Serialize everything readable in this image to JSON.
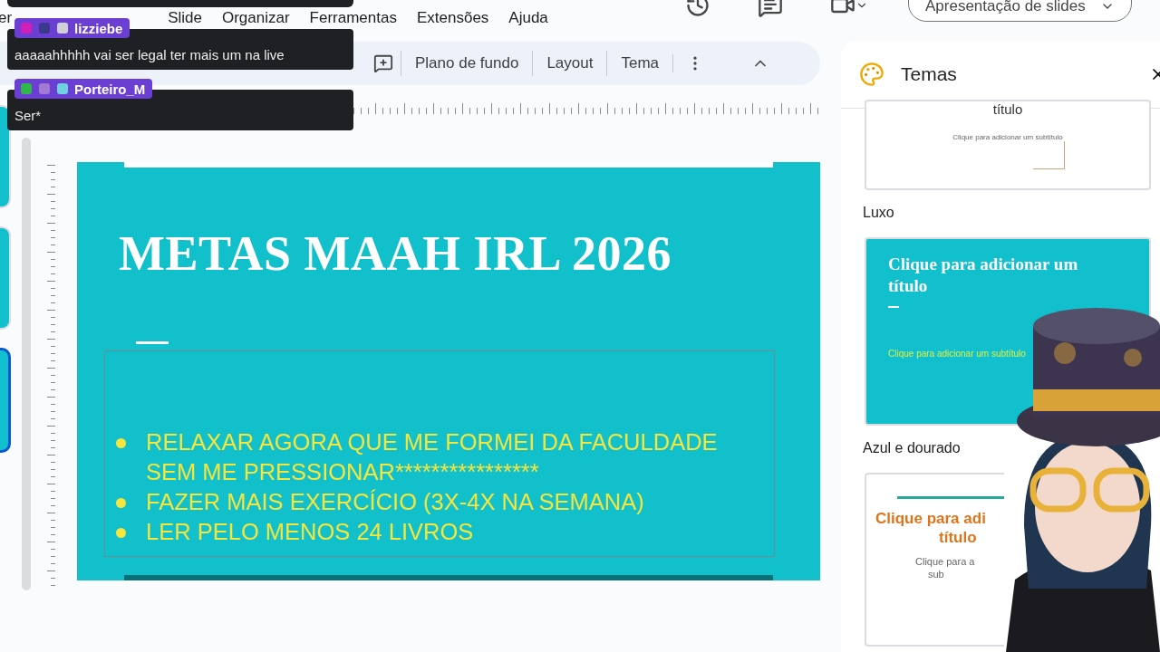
{
  "menu": [
    "er",
    "Slide",
    "Organizar",
    "Ferramentas",
    "Extensões",
    "Ajuda"
  ],
  "toolbar": {
    "buttons": [
      "Plano de fundo",
      "Layout",
      "Tema"
    ]
  },
  "present_button": {
    "label": "Apresentação de slides"
  },
  "slide": {
    "title": "METAS MAAH IRL 2026",
    "bullets": [
      "RELAXAR AGORA QUE ME FORMEI DA FACULDADE SEM ME PRESSIONAR****************",
      "FAZER MAIS EXERCÍCIO (3X-4X NA SEMANA)",
      "LER PELO MENOS 24 LIVROS"
    ]
  },
  "panel": {
    "title": "Temas",
    "themes": [
      {
        "kind": "light",
        "title_lines": [
          "título"
        ],
        "subtitle_lines": [
          "Clique para adicionar um subtítulo"
        ],
        "name": "Luxo"
      },
      {
        "kind": "teal",
        "title_lines": [
          "Clique para adicionar um",
          "título"
        ],
        "subtitle_lines": [
          "Clique para adicionar um subtítulo"
        ],
        "name": "Azul e dourado"
      },
      {
        "kind": "orange",
        "title_lines": [
          "Clique para adi",
          "título"
        ],
        "subtitle_lines": [
          "Clique para a",
          "sub"
        ]
      }
    ]
  },
  "chat": [
    {
      "user": "lizziebe",
      "text": "aaaaahhhhh vai ser legal ter mais um na live"
    },
    {
      "user": "Porteiro_M",
      "text": "Ser*"
    }
  ]
}
